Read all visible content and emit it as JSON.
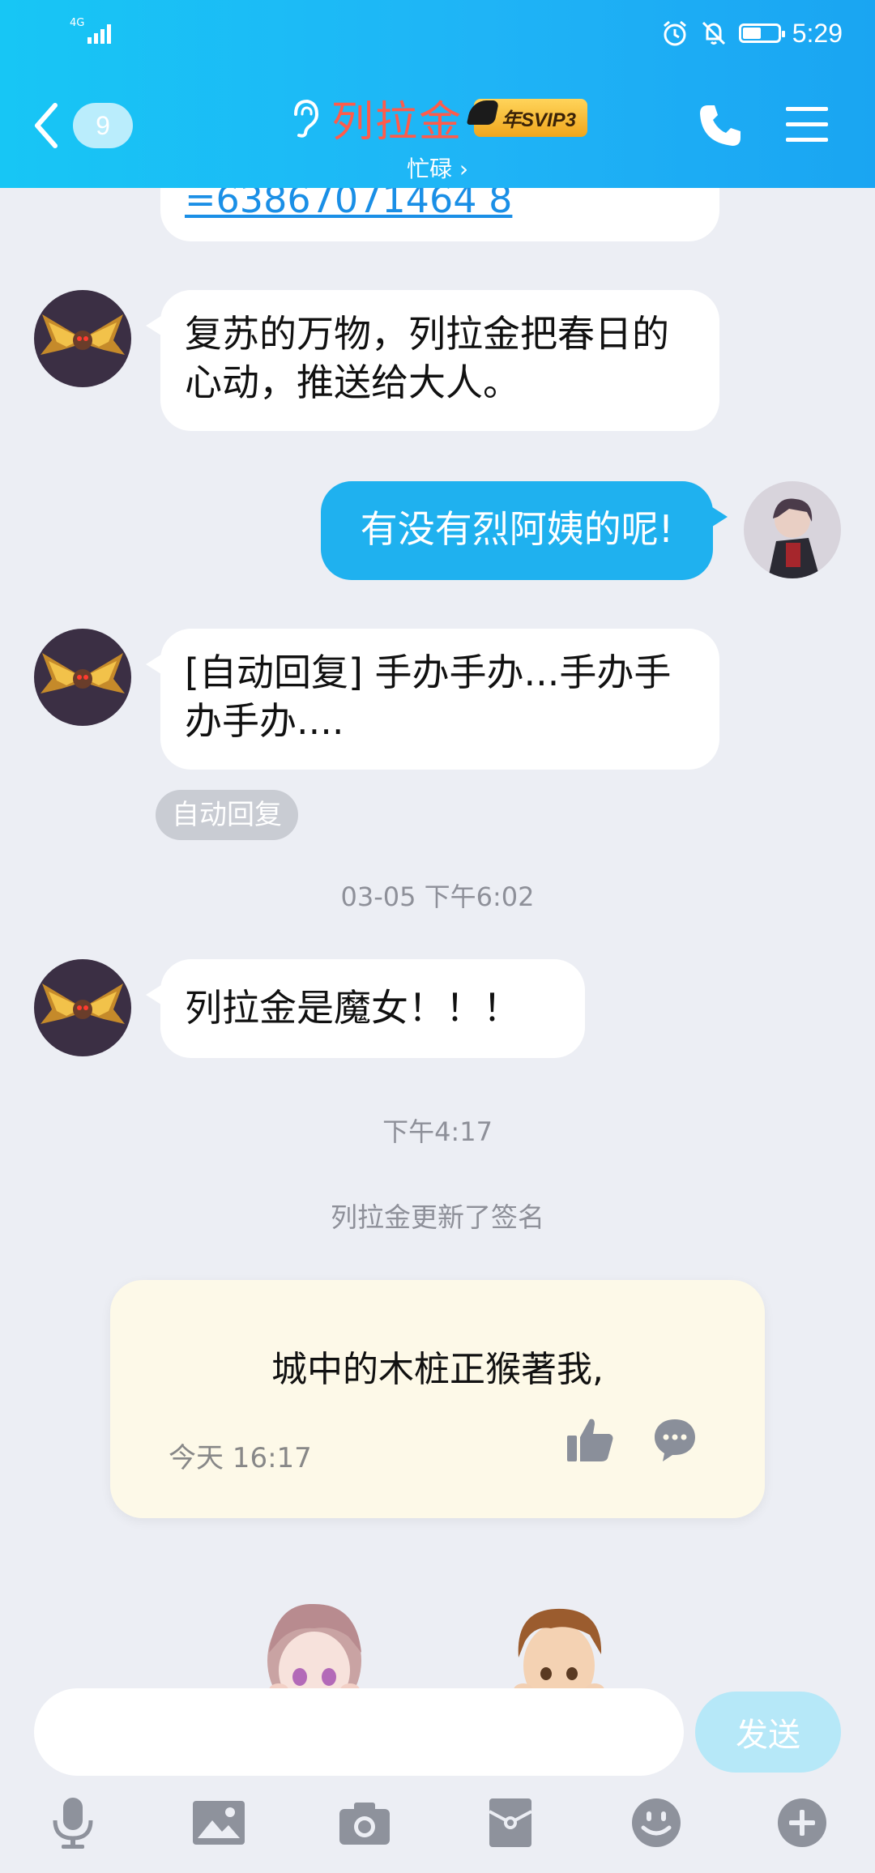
{
  "status_bar": {
    "network": "4G",
    "time": "5:29"
  },
  "header": {
    "unread_count": "9",
    "contact_name": "列拉金",
    "vip_badge": "年SVIP3",
    "contact_status": "忙碌 ›"
  },
  "messages": [
    {
      "side": "in",
      "text": "=63867071464 8"
    },
    {
      "side": "in",
      "text": "复苏的万物，列拉金把春日的心动，推送给大人。"
    },
    {
      "side": "out",
      "text": "有没有烈阿姨的呢!"
    },
    {
      "side": "in",
      "text": "[自动回复] 手办手办...手办手办手办...."
    },
    {
      "side": "in",
      "text": "列拉金是魔女！！！"
    }
  ],
  "auto_reply_tag": "自动回复",
  "timestamps": [
    "03-05 下午6:02",
    "下午4:17"
  ],
  "system_notice": "列拉金更新了签名",
  "signature_card": {
    "text": "城中的木桩正猴著我,",
    "date": "今天 16:17"
  },
  "input": {
    "value": "",
    "placeholder": "",
    "send_label": "发送"
  },
  "toolbar": [
    "voice-icon",
    "image-icon",
    "camera-icon",
    "red-packet-icon",
    "emoji-icon",
    "plus-icon"
  ],
  "colors": {
    "header": "#1fb4f6",
    "outgoing_bubble": "#1fb1ef",
    "name": "#ff5b4a",
    "background": "#eceef4"
  }
}
